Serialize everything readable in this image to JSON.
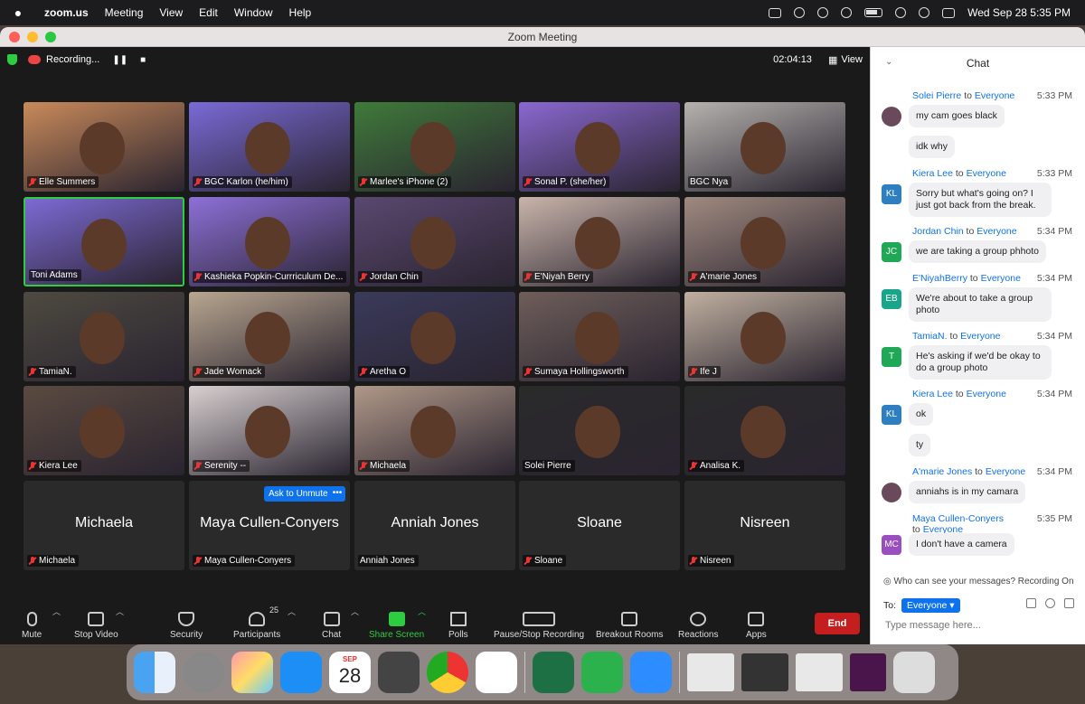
{
  "menubar": {
    "apple": "",
    "app": "zoom.us",
    "items": [
      "Meeting",
      "View",
      "Edit",
      "Window",
      "Help"
    ],
    "clock": "Wed Sep 28  5:35 PM"
  },
  "window": {
    "title": "Zoom Meeting"
  },
  "meeting": {
    "recording_label": "Recording...",
    "timer": "02:04:13",
    "view_label": "View",
    "ask_to_unmute": "Ask to Unmute",
    "more": "•••"
  },
  "tiles": [
    {
      "name": "Elle Summers",
      "muted": true,
      "video": true,
      "color": "#c98a5a"
    },
    {
      "name": "BGC Karlon (he/him)",
      "muted": true,
      "video": true,
      "color": "#7a6ad6"
    },
    {
      "name": "Marlee's iPhone (2)",
      "muted": true,
      "video": true,
      "color": "#3f7a3a"
    },
    {
      "name": "Sonal P. (she/her)",
      "muted": true,
      "video": true,
      "color": "#8a68d0"
    },
    {
      "name": "BGC Nya",
      "muted": false,
      "video": true,
      "color": "#b6b2ae"
    },
    {
      "name": "Toni Adams",
      "muted": false,
      "video": true,
      "color": "#7d6ad4",
      "active": true
    },
    {
      "name": "Kashieka Popkin-Currriculum De...",
      "muted": true,
      "video": true,
      "color": "#8d70d8"
    },
    {
      "name": "Jordan Chin",
      "muted": true,
      "video": true,
      "color": "#5a4870"
    },
    {
      "name": "E'Niyah Berry",
      "muted": true,
      "video": true,
      "color": "#c9b4aa"
    },
    {
      "name": "A'marie Jones",
      "muted": true,
      "video": true,
      "color": "#a08a80"
    },
    {
      "name": "TamiaN.",
      "muted": true,
      "video": true,
      "color": "#4e4a40"
    },
    {
      "name": "Jade Womack",
      "muted": true,
      "video": true,
      "color": "#b8a690"
    },
    {
      "name": "Aretha O",
      "muted": true,
      "video": true,
      "color": "#3a3a5a"
    },
    {
      "name": "Sumaya Hollingsworth",
      "muted": true,
      "video": true,
      "color": "#6e5e5a"
    },
    {
      "name": "Ife J",
      "muted": true,
      "video": true,
      "color": "#c0b0a0"
    },
    {
      "name": "Kiera Lee",
      "muted": true,
      "video": true,
      "color": "#5a4a40"
    },
    {
      "name": "Serenity --",
      "muted": true,
      "video": true,
      "color": "#d8d0d0"
    },
    {
      "name": "Michaela",
      "muted": true,
      "video": true,
      "color": "#b09888"
    },
    {
      "name": "Solei Pierre",
      "muted": false,
      "video": true,
      "color": "#2a2a2a"
    },
    {
      "name": "Analisa K.",
      "muted": true,
      "video": true,
      "color": "#2a2a2a"
    },
    {
      "name": "Michaela",
      "muted": true,
      "video": false,
      "bigname": "Michaela"
    },
    {
      "name": "Maya Cullen-Conyers",
      "muted": true,
      "video": false,
      "bigname": "Maya Cullen-Conyers"
    },
    {
      "name": "Anniah Jones",
      "muted": false,
      "video": false,
      "bigname": "Anniah Jones"
    },
    {
      "name": "Sloane",
      "muted": true,
      "video": false,
      "bigname": "Sloane"
    },
    {
      "name": "Nisreen",
      "muted": true,
      "video": false,
      "bigname": "Nisreen"
    }
  ],
  "toolbar": {
    "mute": "Mute",
    "stop_video": "Stop Video",
    "security": "Security",
    "participants": "Participants",
    "participants_count": "25",
    "chat": "Chat",
    "share_screen": "Share Screen",
    "polls": "Polls",
    "pause_stop_recording": "Pause/Stop Recording",
    "breakout_rooms": "Breakout Rooms",
    "reactions": "Reactions",
    "apps": "Apps",
    "end": "End"
  },
  "chat": {
    "title": "Chat",
    "messages": [
      {
        "sender": "Solei Pierre",
        "to": "to",
        "target": "Everyone",
        "time": "5:33 PM",
        "lines": [
          "my cam goes black",
          "idk why"
        ]
      },
      {
        "sender": "Kiera Lee",
        "to": "to",
        "target": "Everyone",
        "time": "5:33 PM",
        "lines": [
          "Sorry but what's going on? I just got back from the break."
        ],
        "initials": "KL"
      },
      {
        "sender": "Jordan Chin",
        "to": "to",
        "target": "Everyone",
        "time": "5:34 PM",
        "lines": [
          "we are taking a group phhoto"
        ],
        "initials": "JC"
      },
      {
        "sender": "E'NiyahBerry",
        "to": "to",
        "target": "Everyone",
        "time": "5:34 PM",
        "lines": [
          "We're about to take a group photo"
        ],
        "initials": "EB"
      },
      {
        "sender": "TamiaN.",
        "to": "to",
        "target": "Everyone",
        "time": "5:34 PM",
        "lines": [
          "He's asking if we'd be okay to do a group photo"
        ],
        "initials": "T"
      },
      {
        "sender": "Kiera Lee",
        "to": "to",
        "target": "Everyone",
        "time": "5:34 PM",
        "lines": [
          "ok",
          "ty"
        ],
        "initials": "KL"
      },
      {
        "sender": "A'marie Jones",
        "to": "to",
        "target": "Everyone",
        "time": "5:34 PM",
        "lines": [
          "anniahs is in my camara"
        ]
      },
      {
        "sender": "Maya Cullen-Conyers",
        "to": "to",
        "target": "Everyone",
        "time": "5:35 PM",
        "lines": [
          "I don't have a camera"
        ],
        "initials": "MC"
      }
    ],
    "who_can_see": "Who can see your messages? Recording On",
    "to_label": "To:",
    "to_value": "Everyone",
    "input_placeholder": "Type message here..."
  },
  "dock": {
    "calendar_month": "SEP",
    "calendar_day": "28"
  },
  "colors": {
    "zoom_blue": "#0e72ed",
    "active_green": "#2ecc40",
    "end_red": "#c41e1e",
    "avatar_blue": "#2d7fc1",
    "avatar_green": "#1fa855",
    "avatar_teal": "#19a58a",
    "avatar_purple": "#9a4fc0"
  }
}
